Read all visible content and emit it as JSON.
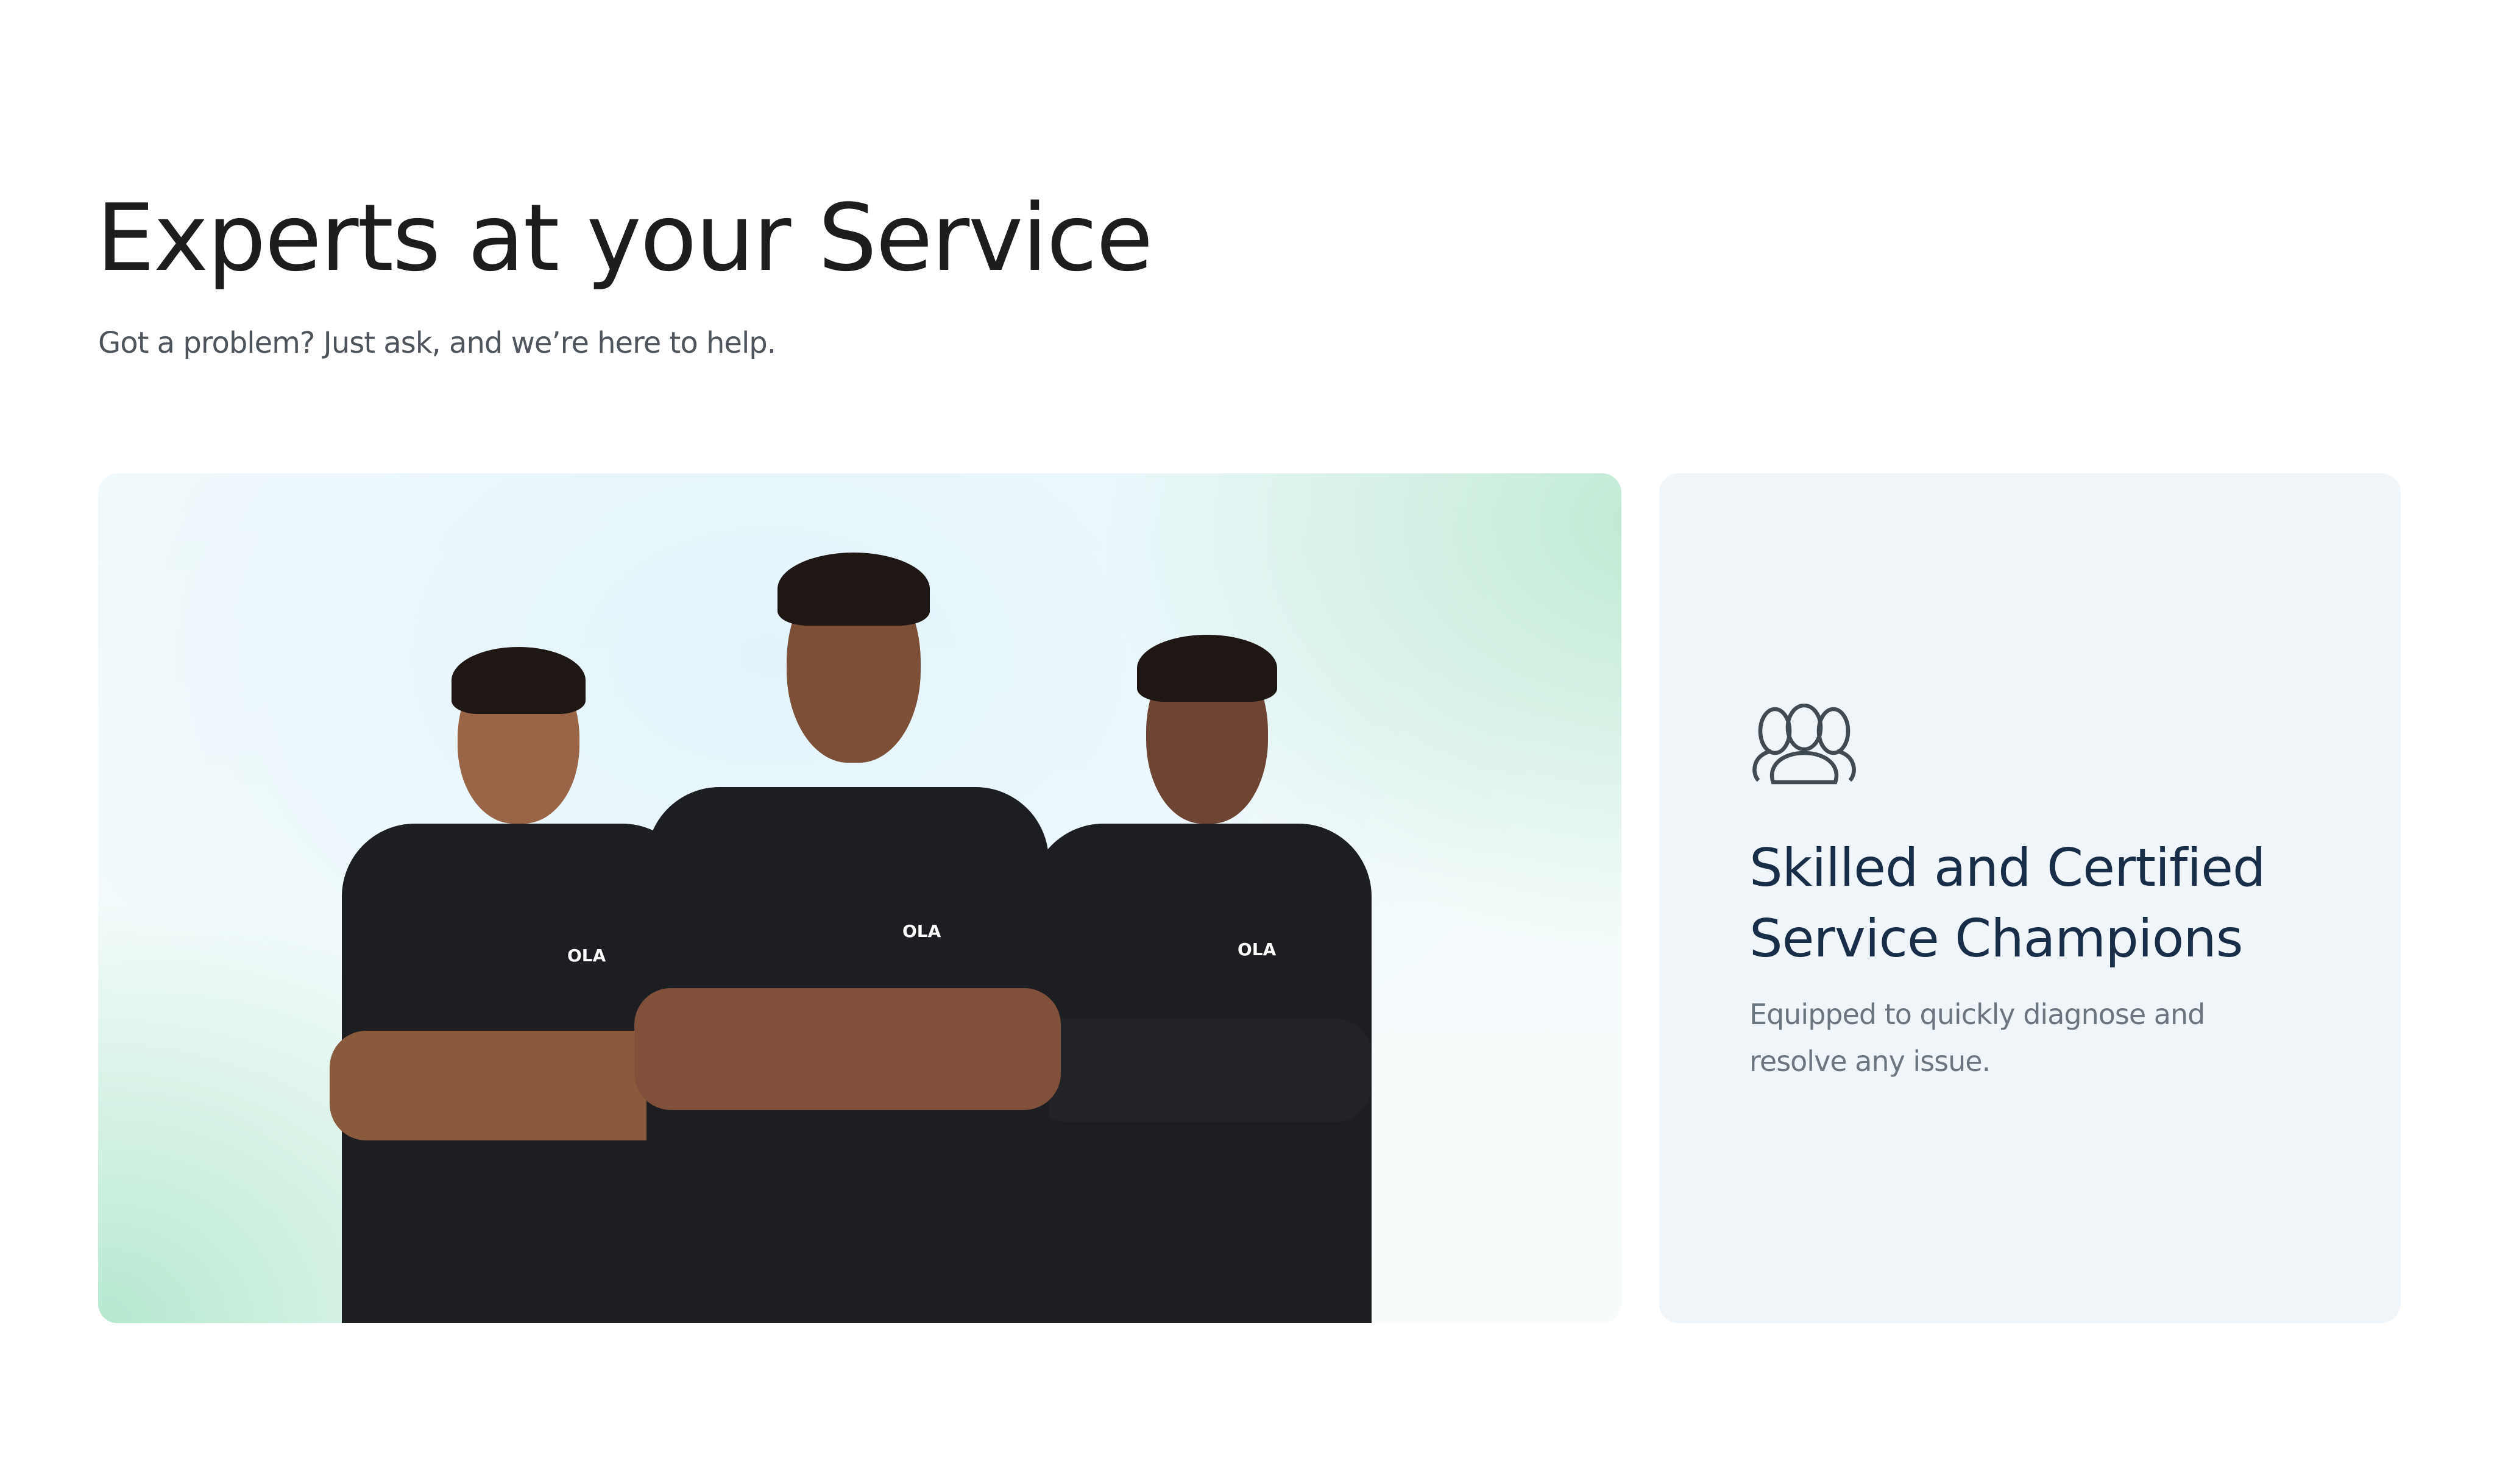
{
  "section": {
    "title": "Experts at your Service",
    "subtitle": "Got a problem? Just ask, and we’re here to help."
  },
  "photo": {
    "shirt_logo": "OLA"
  },
  "feature_card": {
    "icon": "people-group-icon",
    "title": "Skilled and Certified Service Champions",
    "description": "Equipped to quickly diagnose and resolve any issue."
  },
  "colors": {
    "title": "#1b1d1f",
    "card_title": "#172d48",
    "card_bg": "#f0f5f9",
    "card_desc": "#6b7580"
  }
}
